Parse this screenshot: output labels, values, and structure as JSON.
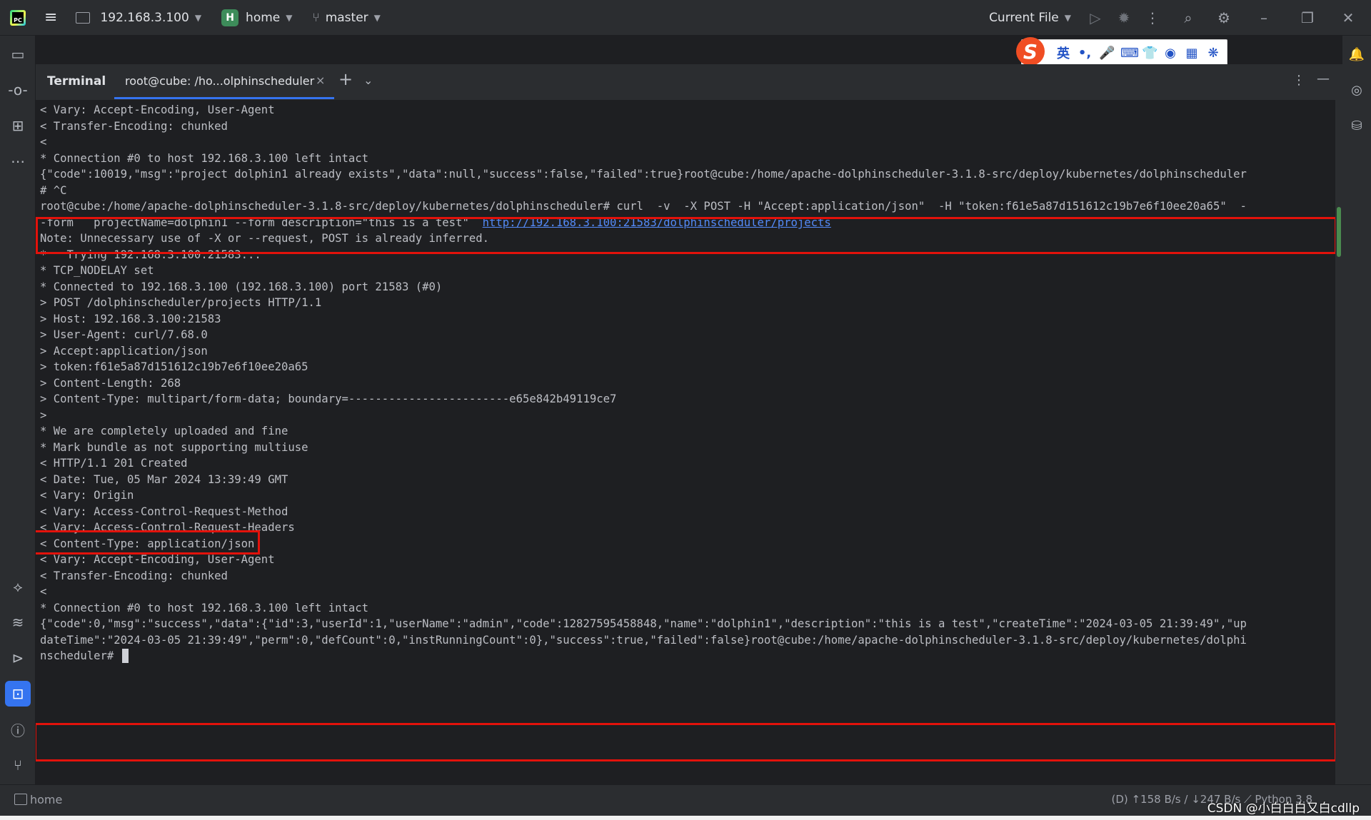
{
  "titlebar": {
    "host": "192.168.3.100",
    "project_badge": "H",
    "project": "home",
    "branch": "master",
    "run_config": "Current File"
  },
  "ime": {
    "logo": "S",
    "items": [
      "英",
      "•,",
      "🎤",
      "⌨",
      "👕",
      "◉",
      "▦",
      "❋"
    ]
  },
  "panel": {
    "title": "Terminal",
    "tab_label": "root@cube: /ho...olphinscheduler",
    "close": "×",
    "add": "+",
    "dropdown": "⌄"
  },
  "terminal": {
    "lines": [
      "< Vary: Accept-Encoding, User-Agent",
      "< Transfer-Encoding: chunked",
      "<",
      "* Connection #0 to host 192.168.3.100 left intact",
      "{\"code\":10019,\"msg\":\"project dolphin1 already exists\",\"data\":null,\"success\":false,\"failed\":true}root@cube:/home/apache-dolphinscheduler-3.1.8-src/deploy/kubernetes/dolphinscheduler",
      "# ^C",
      "root@cube:/home/apache-dolphinscheduler-3.1.8-src/deploy/kubernetes/dolphinscheduler# curl  -v  -X POST -H \"Accept:application/json\"  -H \"token:f61e5a87d151612c19b7e6f10ee20a65\"  -",
      "-form   projectName=dolphin1 --form description=\"this is a test\"  ",
      "Note: Unnecessary use of -X or --request, POST is already inferred.",
      "*   Trying 192.168.3.100:21583...",
      "* TCP_NODELAY set",
      "* Connected to 192.168.3.100 (192.168.3.100) port 21583 (#0)",
      "> POST /dolphinscheduler/projects HTTP/1.1",
      "> Host: 192.168.3.100:21583",
      "> User-Agent: curl/7.68.0",
      "> Accept:application/json",
      "> token:f61e5a87d151612c19b7e6f10ee20a65",
      "> Content-Length: 268",
      "> Content-Type: multipart/form-data; boundary=------------------------e65e842b49119ce7",
      ">",
      "* We are completely uploaded and fine",
      "* Mark bundle as not supporting multiuse",
      "< HTTP/1.1 201 Created",
      "< Date: Tue, 05 Mar 2024 13:39:49 GMT",
      "< Vary: Origin",
      "< Vary: Access-Control-Request-Method",
      "< Vary: Access-Control-Request-Headers",
      "< Content-Type: application/json",
      "< Vary: Accept-Encoding, User-Agent",
      "< Transfer-Encoding: chunked",
      "<",
      "* Connection #0 to host 192.168.3.100 left intact",
      "{\"code\":0,\"msg\":\"success\",\"data\":{\"id\":3,\"userId\":1,\"userName\":\"admin\",\"code\":12827595458848,\"name\":\"dolphin1\",\"description\":\"this is a test\",\"createTime\":\"2024-03-05 21:39:49\",\"up",
      "dateTime\":\"2024-03-05 21:39:49\",\"perm\":0,\"defCount\":0,\"instRunningCount\":0},\"success\":true,\"failed\":false}root@cube:/home/apache-dolphinscheduler-3.1.8-src/deploy/kubernetes/dolphi",
      "nscheduler# "
    ],
    "link": "http://192.168.3.100:21583/dolphinscheduler/projects"
  },
  "status": {
    "workspace": "home",
    "right": "(D) ↑158 B/s / ↓247 B/s   ⟋   Python 3.8"
  },
  "watermark": "CSDN @小白白白又白cdllp",
  "colors": {
    "accent": "#3574f0",
    "highlight": "#e3120b",
    "background": "#1e1f22",
    "chrome": "#2b2d30"
  }
}
